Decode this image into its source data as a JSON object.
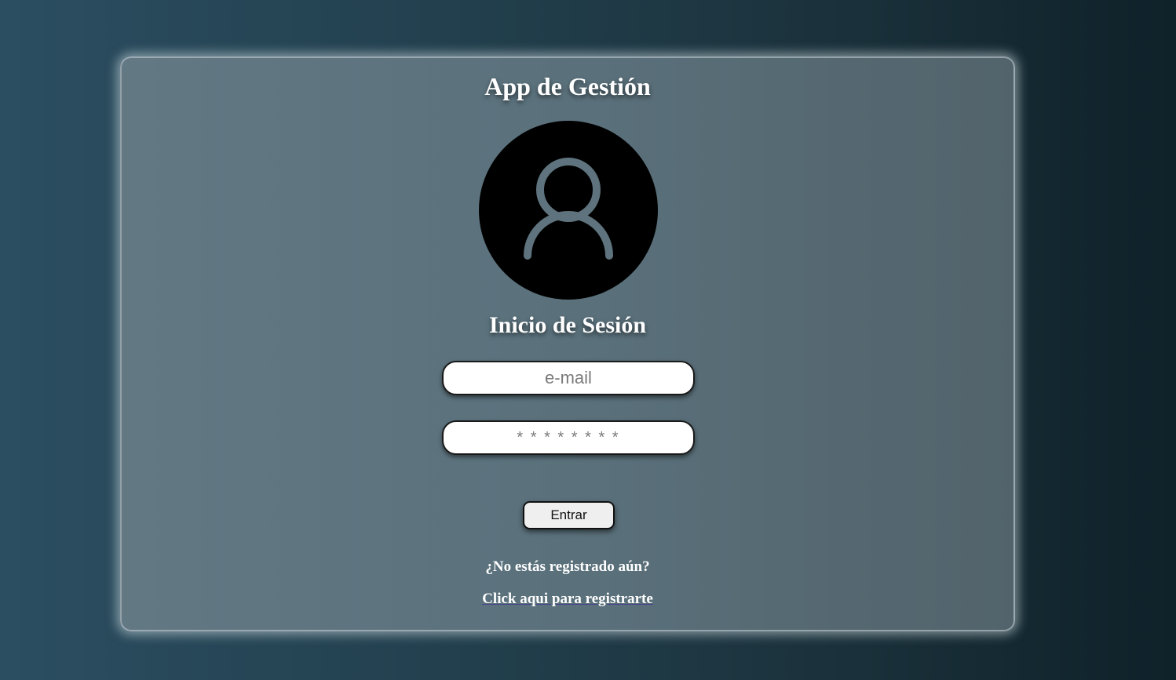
{
  "app": {
    "title": "App de Gestión"
  },
  "avatar": {
    "icon": "user-icon",
    "background": "#000000",
    "icon_color": "#5e737d"
  },
  "login": {
    "heading": "Inicio de Sesión",
    "email_placeholder": "e-mail",
    "password_placeholder": "* * * * * * * *",
    "submit_label": "Entrar"
  },
  "register": {
    "question": "¿No estás registrado aún?",
    "link_label": "Click aqui para registrarte"
  }
}
